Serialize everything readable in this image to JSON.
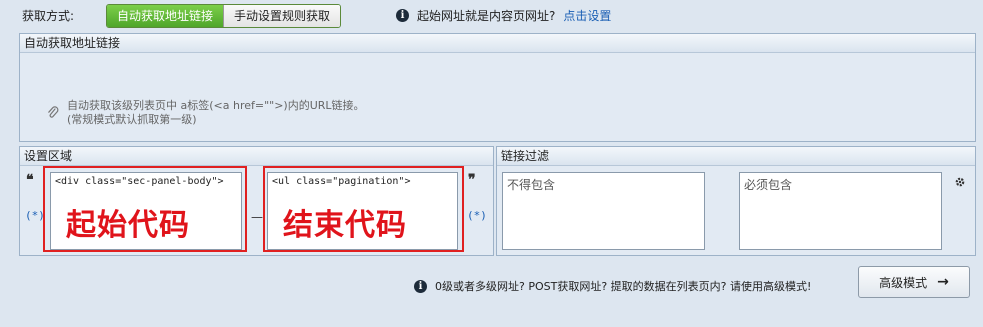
{
  "top": {
    "label": "获取方式:",
    "modes": [
      "自动获取地址链接",
      "手动设置规则获取"
    ],
    "active_mode": "自动获取地址链接",
    "info_text": "起始网址就是内容页网址?",
    "info_link": "点击设置"
  },
  "auto_panel": {
    "title": "自动获取地址链接",
    "desc_line1": "自动获取该级列表页中 a标签(<a href=\"\">)内的URL链接。",
    "desc_line2": "(常规模式默认抓取第一级)"
  },
  "settings_panel": {
    "title": "设置区域",
    "open_quote": "❝",
    "close_quote": "❞",
    "wildcard": "(*)",
    "separator": "—",
    "start_code": "<div class=\"sec-panel-body\">",
    "end_code": "<ul class=\"pagination\">",
    "start_label": "起始代码",
    "end_label": "结束代码"
  },
  "filter_panel": {
    "title": "链接过滤",
    "exclude_placeholder": "不得包含",
    "include_placeholder": "必须包含"
  },
  "bottom": {
    "info_text": "0级或者多级网址? POST获取网址? 提取的数据在列表页内? 请使用高级模式!",
    "advanced_button": "高级模式"
  },
  "icons": [
    "info-icon",
    "paperclip-icon",
    "gear-icon",
    "arrow-right-icon"
  ],
  "colors": {
    "active_tab": "#4fa62a",
    "link": "#1a5fb4",
    "annotation_red": "#e0141b"
  }
}
